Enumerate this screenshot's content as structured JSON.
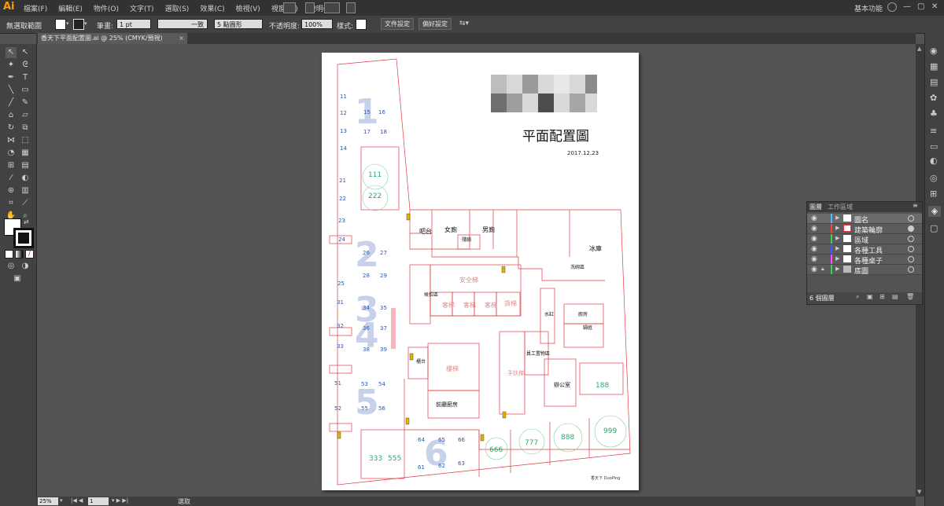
{
  "app": {
    "logo": "Ai"
  },
  "menu": [
    "檔案(F)",
    "編輯(E)",
    "物件(O)",
    "文字(T)",
    "選取(S)",
    "效果(C)",
    "檢視(V)",
    "視窗(W)",
    "說明(H)"
  ],
  "workspace": "基本功能",
  "control": {
    "selection": "無選取範圍",
    "stroke_label": "筆畫:",
    "stroke_value": "1 pt",
    "stroke_style": "一致",
    "brush": "5 點圓形",
    "opacity_label": "不透明度:",
    "opacity_value": "100%",
    "style_label": "樣式:",
    "doc_setup": "文件設定",
    "prefs": "偏好設定"
  },
  "document_tab": "香天下平面配置圖.ai @ 25% (CMYK/預視)",
  "status": {
    "zoom": "25%",
    "artboard": "1",
    "tool": "選取"
  },
  "plan": {
    "title": "平面配置圖",
    "date": "2017.12.23",
    "brand": "香天下 DuoPing",
    "rooms": [
      "吧台",
      "女廁",
      "男廁",
      "殘廁",
      "冰庫",
      "洗碗區",
      "安全梯",
      "客梯",
      "客梯",
      "客梯",
      "貨梯",
      "候位區",
      "水缸",
      "廚房",
      "鍋庭",
      "櫃台",
      "樓梯",
      "手扶梯",
      "員工置物區",
      "辦公室",
      "前廳廚房"
    ],
    "zones": [
      "1",
      "2",
      "3",
      "4",
      "5",
      "6"
    ],
    "tables_left": [
      "11",
      "12",
      "13",
      "14",
      "21",
      "22",
      "23",
      "24",
      "25",
      "31",
      "32",
      "33",
      "51",
      "52"
    ],
    "tables_inner": [
      "15",
      "16",
      "17",
      "18",
      "26",
      "27",
      "28",
      "29",
      "34",
      "35",
      "36",
      "37",
      "38",
      "39",
      "53",
      "54",
      "55",
      "56"
    ],
    "tables_bottom": [
      "61",
      "62",
      "63",
      "64",
      "65",
      "66"
    ],
    "vip": [
      "111",
      "222",
      "188",
      "333",
      "555",
      "666",
      "777",
      "888",
      "999"
    ]
  },
  "layers_panel": {
    "tabs": [
      "圖層",
      "工作區域"
    ],
    "layers": [
      {
        "name": "圖名",
        "color": "#4fb8ff"
      },
      {
        "name": "建築輪廓",
        "color": "#ff3b3b"
      },
      {
        "name": "區域",
        "color": "#39d353"
      },
      {
        "name": "各種工具",
        "color": "#3a5bff"
      },
      {
        "name": "各種桌子",
        "color": "#ff45ff"
      },
      {
        "name": "底圖",
        "color": "#39d353"
      }
    ],
    "count": "6 個圖層"
  },
  "colors": {
    "wall": "#e23a44",
    "table": "#2f5aa8",
    "vip": "#2ea86b",
    "zone": "#b7c3e0",
    "stair": "#e08a8a"
  }
}
